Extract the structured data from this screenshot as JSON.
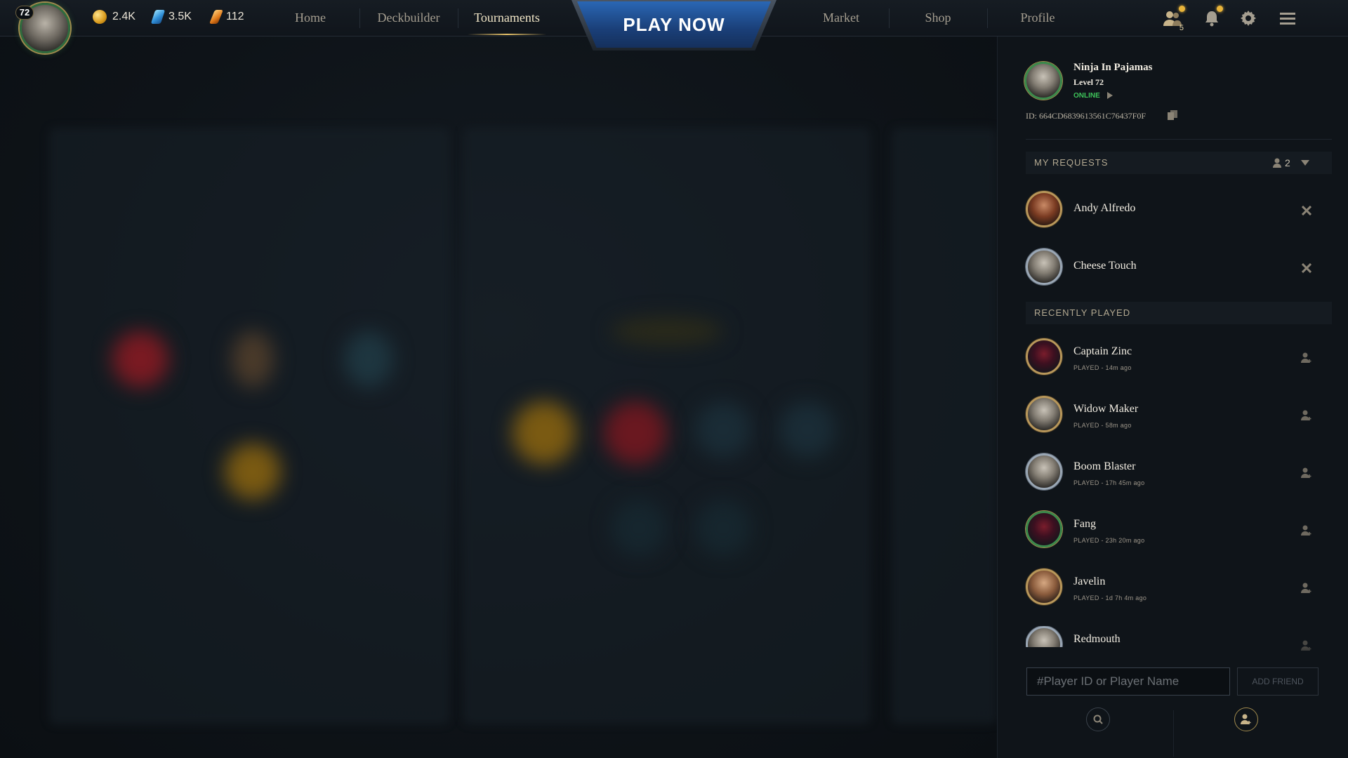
{
  "topbar": {
    "player_level": "72",
    "currencies": [
      {
        "icon": "gold-coin-icon",
        "value": "2.4K"
      },
      {
        "icon": "gem-icon",
        "value": "3.5K"
      },
      {
        "icon": "shard-icon",
        "value": "112"
      }
    ],
    "nav": [
      "Home",
      "Deckbuilder",
      "Tournaments",
      "Market",
      "Shop",
      "Profile"
    ],
    "active_nav": "Tournaments",
    "play_now": "PLAY NOW",
    "friends_count": "5",
    "accent": "#e9b43a"
  },
  "profile": {
    "name": "Ninja In Pajamas",
    "level": "Level 72",
    "status": "ONLINE",
    "status_color": "#3ec45a",
    "id": "ID: 664CD6839613561C76437F0F"
  },
  "requests": {
    "title": "MY REQUESTS",
    "count": "2",
    "items": [
      {
        "name": "Andy Alfredo"
      },
      {
        "name": "Cheese Touch"
      }
    ]
  },
  "recent": {
    "title": "RECENTLY PLAYED",
    "items": [
      {
        "name": "Captain Zinc",
        "played": "PLAYED - 14m ago"
      },
      {
        "name": "Widow Maker",
        "played": "PLAYED - 58m ago"
      },
      {
        "name": "Boom Blaster",
        "played": "PLAYED - 17h 45m ago"
      },
      {
        "name": "Fang",
        "played": "PLAYED - 23h 20m ago"
      },
      {
        "name": "Javelin",
        "played": "PLAYED - 1d 7h 4m ago"
      },
      {
        "name": "Redmouth",
        "played": ""
      }
    ]
  },
  "search": {
    "placeholder": "#Player ID or Player Name",
    "add_friend_label": "ADD FRIEND"
  }
}
